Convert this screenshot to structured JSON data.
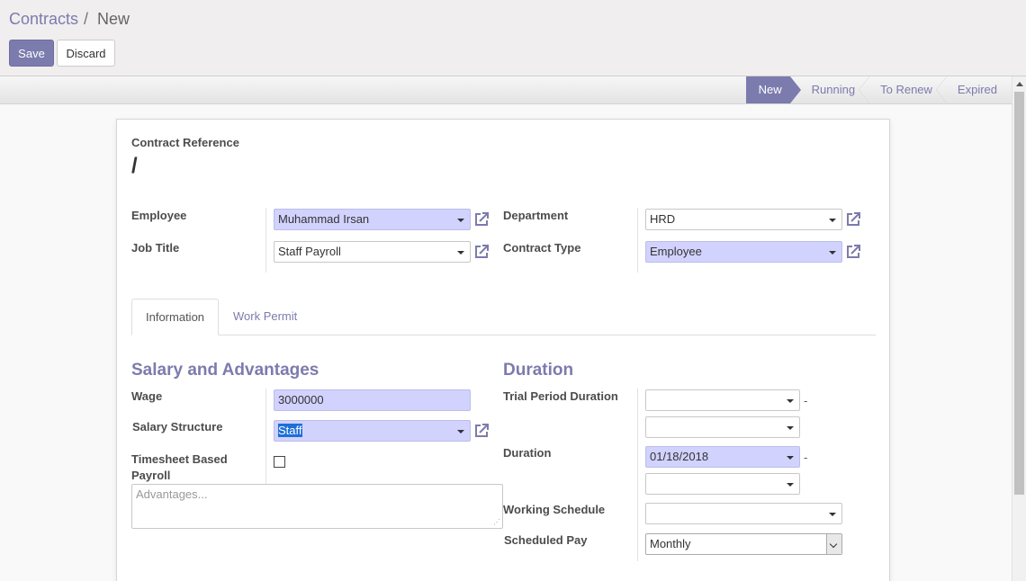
{
  "breadcrumb": {
    "parent": "Contracts",
    "separator": "/",
    "current": "New"
  },
  "buttons": {
    "save": "Save",
    "discard": "Discard"
  },
  "statusbar": {
    "stages": [
      "New",
      "Running",
      "To Renew",
      "Expired"
    ],
    "active": "New"
  },
  "header": {
    "label": "Contract Reference",
    "value": "/"
  },
  "fields": {
    "employee": {
      "label": "Employee",
      "value": "Muhammad Irsan"
    },
    "job_title": {
      "label": "Job Title",
      "value": "Staff Payroll"
    },
    "department": {
      "label": "Department",
      "value": "HRD"
    },
    "contract_type": {
      "label": "Contract Type",
      "value": "Employee"
    }
  },
  "tabs": [
    "Information",
    "Work Permit"
  ],
  "salary": {
    "title": "Salary and Advantages",
    "wage_label": "Wage",
    "wage_value": "3000000",
    "structure_label": "Salary Structure",
    "structure_value": "Staff",
    "timesheet_label_1": "Timesheet Based",
    "timesheet_label_2": "Payroll",
    "advantages_placeholder": "Advantages..."
  },
  "duration": {
    "title": "Duration",
    "trial_label": "Trial Period Duration",
    "trial_start": "",
    "trial_end": "",
    "duration_label": "Duration",
    "duration_start": "01/18/2018",
    "duration_end": "",
    "schedule_label": "Working Schedule",
    "schedule_value": "",
    "scheduled_pay_label": "Scheduled Pay",
    "scheduled_pay_value": "Monthly",
    "dash": "-"
  },
  "colors": {
    "accent": "#7c7bad",
    "required_bg": "#d2d2ff"
  },
  "icons": {
    "external_link": "external-link-icon",
    "dropdown": "caret-down-icon"
  }
}
